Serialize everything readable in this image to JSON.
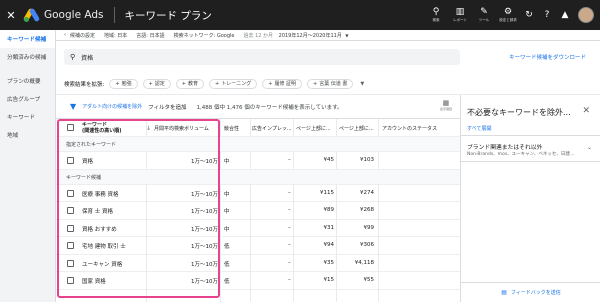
{
  "topbar": {
    "app_name": "Google Ads",
    "page_title": "キーワード プラン",
    "tools": [
      {
        "label": "検索",
        "icon": "search-icon"
      },
      {
        "label": "レポート",
        "icon": "bar-chart-icon"
      },
      {
        "label": "ツール",
        "icon": "wrench-icon"
      },
      {
        "label": "設定と請求",
        "icon": "gear-icon"
      }
    ]
  },
  "sidebar": {
    "items": [
      {
        "label": "キーワード候補",
        "active": true
      },
      {
        "label": "分類済みの候補",
        "active": false
      },
      {
        "label": "プランの概要",
        "active": false
      },
      {
        "label": "広告グループ",
        "active": false
      },
      {
        "label": "キーワード",
        "active": false
      },
      {
        "label": "地域",
        "active": false
      }
    ]
  },
  "subheader": {
    "settings_label": "候補の設定",
    "location": "地域: 日本",
    "language": "言語: 日本語",
    "network": "検索ネットワーク: Google",
    "period_label": "過去 12 か月",
    "period_value": "2019年12月～2020年11月"
  },
  "search": {
    "value": "資格",
    "download_label": "キーワード候補をダウンロード"
  },
  "refine": {
    "label": "検索結果を拡張:",
    "chips": [
      "勉強",
      "認定",
      "教育",
      "トレーニング",
      "履修 証明",
      "言葉 伝道 書"
    ]
  },
  "filter": {
    "hint": "アダルト向けの候補を除外",
    "add_filter": "フィルタを追加",
    "result_info": "1,488 個中 1,476 個のキーワード候補を表示しています。",
    "columns_label": "表示項目"
  },
  "table": {
    "headers": {
      "keyword": "キーワード",
      "keyword_sub": "(関連性の高い順)",
      "volume": "月間平均検索ボリューム",
      "competition": "競合性",
      "impression_share": "広告インプレッ...",
      "bid_low": "ページ上部に...",
      "bid_high": "ページ上部に...",
      "status": "アカウントのステータス"
    },
    "groups": [
      {
        "label": "指定されたキーワード",
        "rows": [
          {
            "keyword": "資格",
            "volume": "1万～10万",
            "competition": "中",
            "impression_share": "–",
            "bid_low": "¥45",
            "bid_high": "¥103"
          }
        ]
      },
      {
        "label": "キーワード候補",
        "rows": [
          {
            "keyword": "医療 事務 資格",
            "volume": "1万～10万",
            "competition": "中",
            "impression_share": "–",
            "bid_low": "¥115",
            "bid_high": "¥274"
          },
          {
            "keyword": "保育 士 資格",
            "volume": "1万～10万",
            "competition": "中",
            "impression_share": "–",
            "bid_low": "¥89",
            "bid_high": "¥268"
          },
          {
            "keyword": "資格 おすすめ",
            "volume": "1万～10万",
            "competition": "中",
            "impression_share": "–",
            "bid_low": "¥31",
            "bid_high": "¥99"
          },
          {
            "keyword": "宅地 建物 取引 士",
            "volume": "1万～10万",
            "competition": "低",
            "impression_share": "–",
            "bid_low": "¥94",
            "bid_high": "¥306"
          },
          {
            "keyword": "ユーキャン 資格",
            "volume": "1万～10万",
            "competition": "低",
            "impression_share": "–",
            "bid_low": "¥35",
            "bid_high": "¥4,118"
          },
          {
            "keyword": "国家 資格",
            "volume": "1万～10万",
            "competition": "低",
            "impression_share": "–",
            "bid_low": "¥15",
            "bid_high": "¥55"
          }
        ]
      }
    ]
  },
  "right_panel": {
    "title": "不必要なキーワードを除外...",
    "expand_all": "すべて展開",
    "item_title": "ブランド関連またはそれ以外",
    "item_sub": "Non-Brands、mos、ユーキャン、ベネッセ、日建...",
    "feedback": "フィードバックを送信"
  },
  "colors": {
    "accent": "#1a73e8",
    "highlight": "#e8438d",
    "topbar": "#1f1f1f"
  }
}
